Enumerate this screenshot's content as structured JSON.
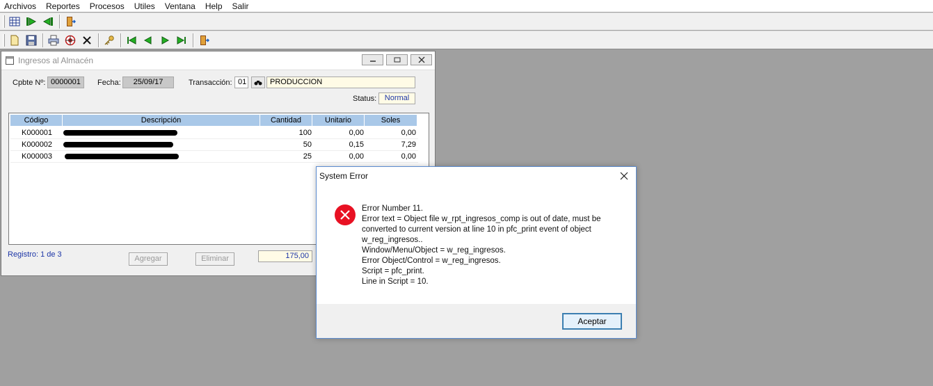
{
  "menu": [
    "Archivos",
    "Reportes",
    "Procesos",
    "Utiles",
    "Ventana",
    "Help",
    "Salir"
  ],
  "toolbar1": {
    "icons": [
      "grid-icon",
      "go-forward-icon",
      "go-back-icon",
      "exit-door-icon"
    ]
  },
  "toolbar2": {
    "icons": [
      "new-document-icon",
      "save-icon",
      "print-icon",
      "target-icon",
      "delete-x-icon",
      "key-icon",
      "first-record-icon",
      "previous-record-icon",
      "next-record-icon",
      "last-record-icon",
      "exit-door-icon"
    ]
  },
  "child_window": {
    "title": "Ingresos al Almacén",
    "cpbte_label": "Cpbte Nº:",
    "cpbte_value": "0000001",
    "fecha_label": "Fecha:",
    "fecha_value": "25/09/17",
    "transaccion_label": "Transacción:",
    "transaccion_code": "01",
    "transaccion_name": "PRODUCCION",
    "status_label": "Status:",
    "status_value": "Normal",
    "grid": {
      "columns": [
        "Código",
        "Descripción",
        "Cantidad",
        "Unitario",
        "Soles"
      ],
      "rows": [
        {
          "codigo": "K000001",
          "cantidad": "100",
          "unitario": "0,00",
          "soles": "0,00"
        },
        {
          "codigo": "K000002",
          "cantidad": "50",
          "unitario": "0,15",
          "soles": "7,29"
        },
        {
          "codigo": "K000003",
          "cantidad": "25",
          "unitario": "0,00",
          "soles": "0,00"
        }
      ]
    },
    "registro": "Registro: 1 de 3",
    "agregar_label": "Agregar",
    "eliminar_label": "Eliminar",
    "total": "175,00"
  },
  "dialog": {
    "title": "System Error",
    "lines": [
      "Error Number 11.",
      "Error text = Object file w_rpt_ingresos_comp is out of date, must be converted to current version at line 10 in pfc_print event of object w_reg_ingresos..",
      "Window/Menu/Object = w_reg_ingresos.",
      "Error Object/Control = w_reg_ingresos.",
      "Script = pfc_print.",
      "Line in Script = 10."
    ],
    "ok_label": "Aceptar"
  },
  "colors": {
    "desktop": "#a0a0a0",
    "grid_header": "#a9c8e8",
    "link_blue": "#1c35a6",
    "error_red": "#e81123",
    "dialog_border": "#5b8bd0"
  }
}
